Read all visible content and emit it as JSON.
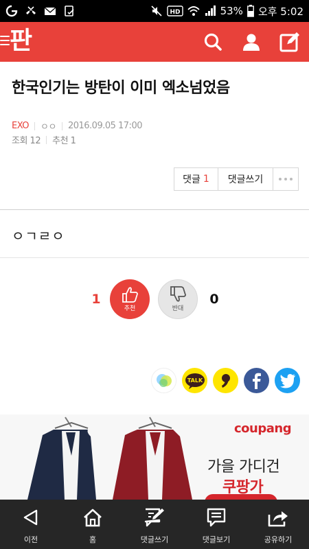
{
  "status_bar": {
    "battery_percent": "53%",
    "time": "오후 5:02",
    "hd_label": "HD"
  },
  "app": {
    "logo": "판",
    "accent_color": "#e8413a"
  },
  "article": {
    "title": "한국인기는 방탄이 이미 엑소넘었음",
    "category": "EXO",
    "author": "ㅇㅇ",
    "date": "2016.09.05 17:00",
    "views_label": "조회 12",
    "recommend_label": "추천 1",
    "body": "ㅇㄱㄹㅇ"
  },
  "actions": {
    "comments_label": "댓글",
    "comments_count": "1",
    "write_comment_label": "댓글쓰기"
  },
  "votes": {
    "up_count": "1",
    "up_label": "추천",
    "down_count": "0",
    "down_label": "반대"
  },
  "share": {
    "talk_label": "TALK"
  },
  "ad": {
    "brand": "coupang",
    "line1": "가을 가디건",
    "line2": "쿠팡가"
  },
  "bottom_nav": {
    "items": [
      {
        "label": "이전",
        "icon": "back-icon"
      },
      {
        "label": "홈",
        "icon": "home-icon"
      },
      {
        "label": "댓글쓰기",
        "icon": "write-comment-icon"
      },
      {
        "label": "댓글보기",
        "icon": "view-comments-icon"
      },
      {
        "label": "공유하기",
        "icon": "share-icon"
      }
    ]
  }
}
